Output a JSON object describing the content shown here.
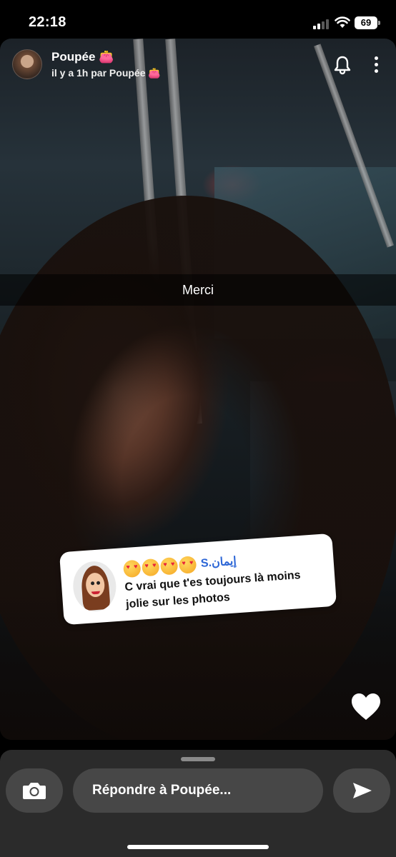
{
  "status_bar": {
    "time": "22:18",
    "battery_level": "69"
  },
  "story": {
    "author_name": "Poupée",
    "author_emoji": "👛",
    "subtitle": "il y a 1h par Poupée",
    "subtitle_emoji": "👛",
    "caption": "Merci"
  },
  "reply_card": {
    "username": "S.إيمان",
    "emoji_count": 4,
    "message": "C vrai que t'es toujours là moins jolie sur les photos"
  },
  "bottom_bar": {
    "reply_placeholder": "Répondre à Poupée..."
  },
  "icons": [
    "bell-icon",
    "more-options-icon",
    "heart-icon",
    "camera-icon",
    "send-icon"
  ]
}
